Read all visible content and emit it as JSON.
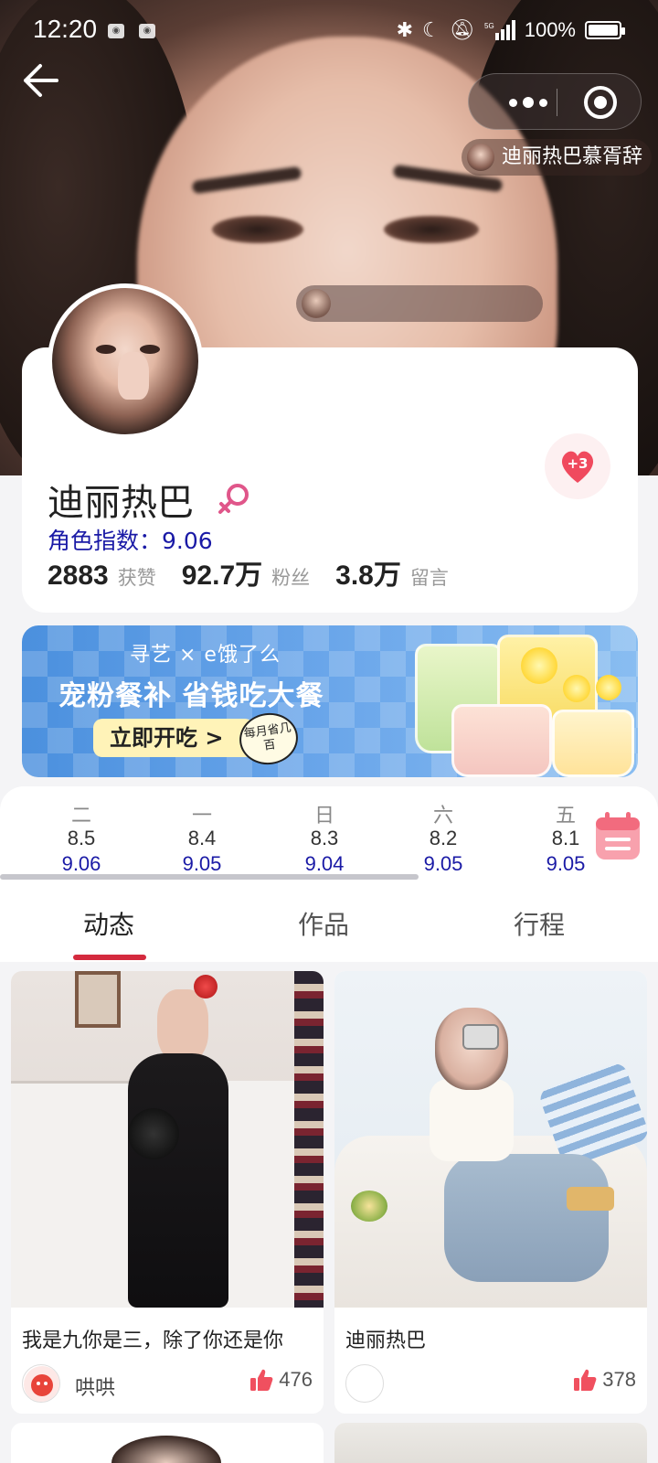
{
  "status_bar": {
    "time": "12:20",
    "battery": "100%"
  },
  "header": {
    "mini_profile_name": "迪丽热巴慕胥辞"
  },
  "profile": {
    "name": "迪丽热巴",
    "role_index": "角色指数：9.06",
    "like_badge": "+3",
    "stats": [
      {
        "value": "2883",
        "label": "获赞"
      },
      {
        "value": "92.7万",
        "label": "粉丝"
      },
      {
        "value": "3.8万",
        "label": "留言"
      }
    ]
  },
  "banner": {
    "brand": "寻艺 × e饿了么",
    "headline": "宠粉餐补 省钱吃大餐",
    "cta": "立即开吃 >",
    "stamp": "每月省几百"
  },
  "date_strip": {
    "days": [
      {
        "weekday": "二",
        "date": "8.5",
        "value": "9.06"
      },
      {
        "weekday": "一",
        "date": "8.4",
        "value": "9.05"
      },
      {
        "weekday": "日",
        "date": "8.3",
        "value": "9.04"
      },
      {
        "weekday": "六",
        "date": "8.2",
        "value": "9.05"
      },
      {
        "weekday": "五",
        "date": "8.1",
        "value": "9.05"
      }
    ],
    "scroll_progress": 0.64
  },
  "tabs": [
    {
      "label": "动态",
      "active": true
    },
    {
      "label": "作品",
      "active": false
    },
    {
      "label": "行程",
      "active": false
    }
  ],
  "feed": [
    {
      "caption": "我是九你是三，除了你还是你",
      "author": "哄哄",
      "likes": "476"
    },
    {
      "caption": "迪丽热巴",
      "author": "",
      "likes": "378"
    }
  ],
  "colors": {
    "accent_red": "#d42a3e",
    "index_blue": "#1a1aa6",
    "banner_blue": "#4b90de",
    "heart_pink": "#f04a5e"
  }
}
